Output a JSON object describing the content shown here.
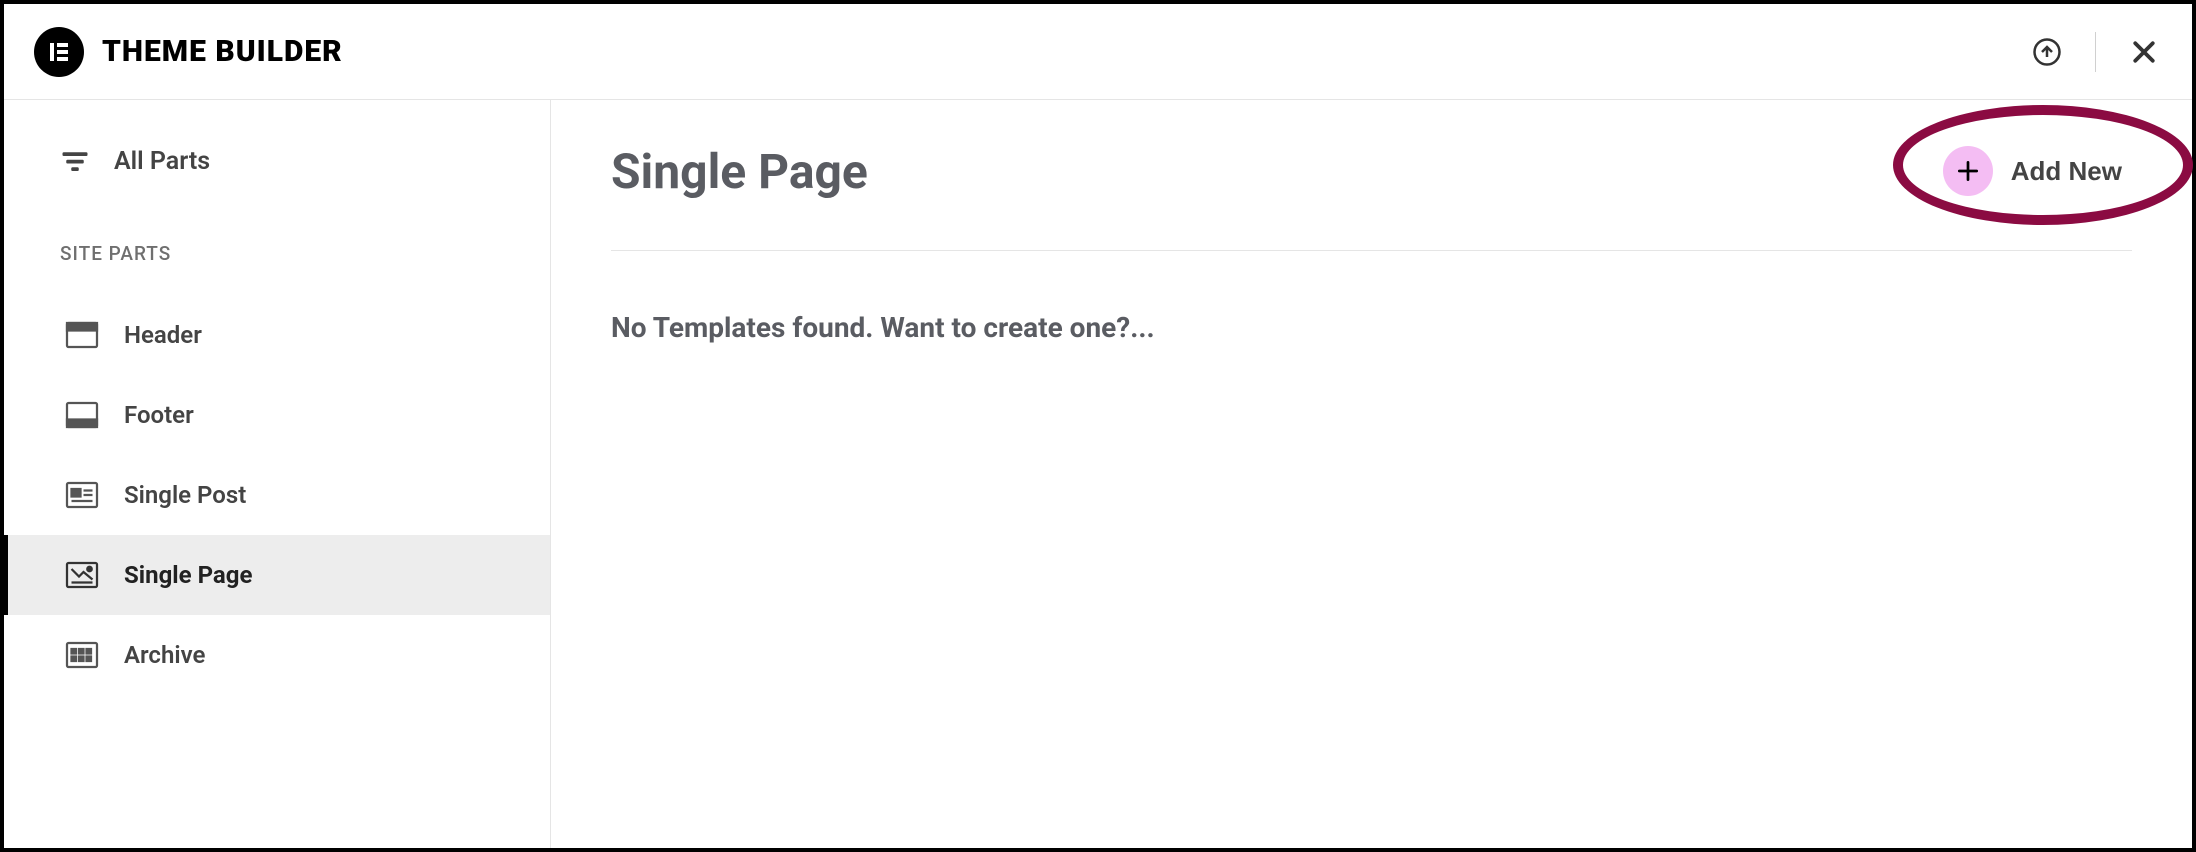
{
  "header": {
    "title": "THEME BUILDER",
    "logo_glyph": "E"
  },
  "sidebar": {
    "all_parts_label": "All Parts",
    "section_heading": "SITE PARTS",
    "items": [
      {
        "label": "Header",
        "active": false,
        "icon": "header"
      },
      {
        "label": "Footer",
        "active": false,
        "icon": "footer"
      },
      {
        "label": "Single Post",
        "active": false,
        "icon": "single-post"
      },
      {
        "label": "Single Page",
        "active": true,
        "icon": "single-page"
      },
      {
        "label": "Archive",
        "active": false,
        "icon": "archive"
      }
    ]
  },
  "main": {
    "page_title": "Single Page",
    "add_new_label": "Add New",
    "empty_state": "No Templates found. Want to create one?..."
  }
}
